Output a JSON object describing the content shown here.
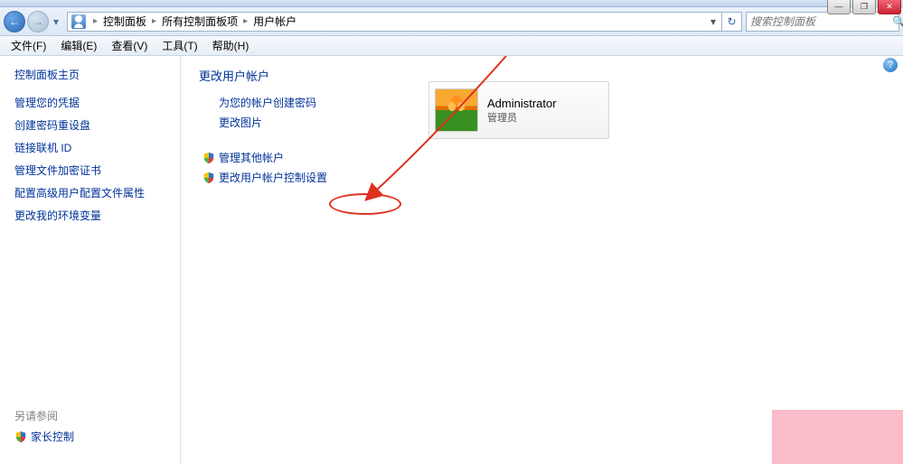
{
  "titlebar": {
    "minimize": "—",
    "maximize": "❐",
    "close": "✕"
  },
  "nav": {
    "back": "←",
    "forward": "→",
    "dropdown": "▾",
    "refresh": "↻",
    "addr_dropdown": "▾"
  },
  "breadcrumbs": {
    "root": "控制面板",
    "mid": "所有控制面板项",
    "leaf": "用户帐户",
    "sep": "▸"
  },
  "search": {
    "placeholder": "搜索控制面板",
    "icon": "🔍"
  },
  "menu": {
    "file": "文件(F)",
    "edit": "编辑(E)",
    "view": "查看(V)",
    "tools": "工具(T)",
    "help": "帮助(H)"
  },
  "sidebar": {
    "heading": "控制面板主页",
    "items": [
      "管理您的凭据",
      "创建密码重设盘",
      "链接联机 ID",
      "管理文件加密证书",
      "配置高级用户配置文件属性",
      "更改我的环境变量"
    ],
    "see_also": "另请参阅",
    "parental": "家长控制"
  },
  "main": {
    "heading": "更改用户帐户",
    "tasks_plain": [
      "为您的帐户创建密码",
      "更改图片"
    ],
    "tasks_shield": [
      "管理其他帐户",
      "更改用户帐户控制设置"
    ]
  },
  "account": {
    "name": "Administrator",
    "role": "管理员"
  },
  "help": "?"
}
